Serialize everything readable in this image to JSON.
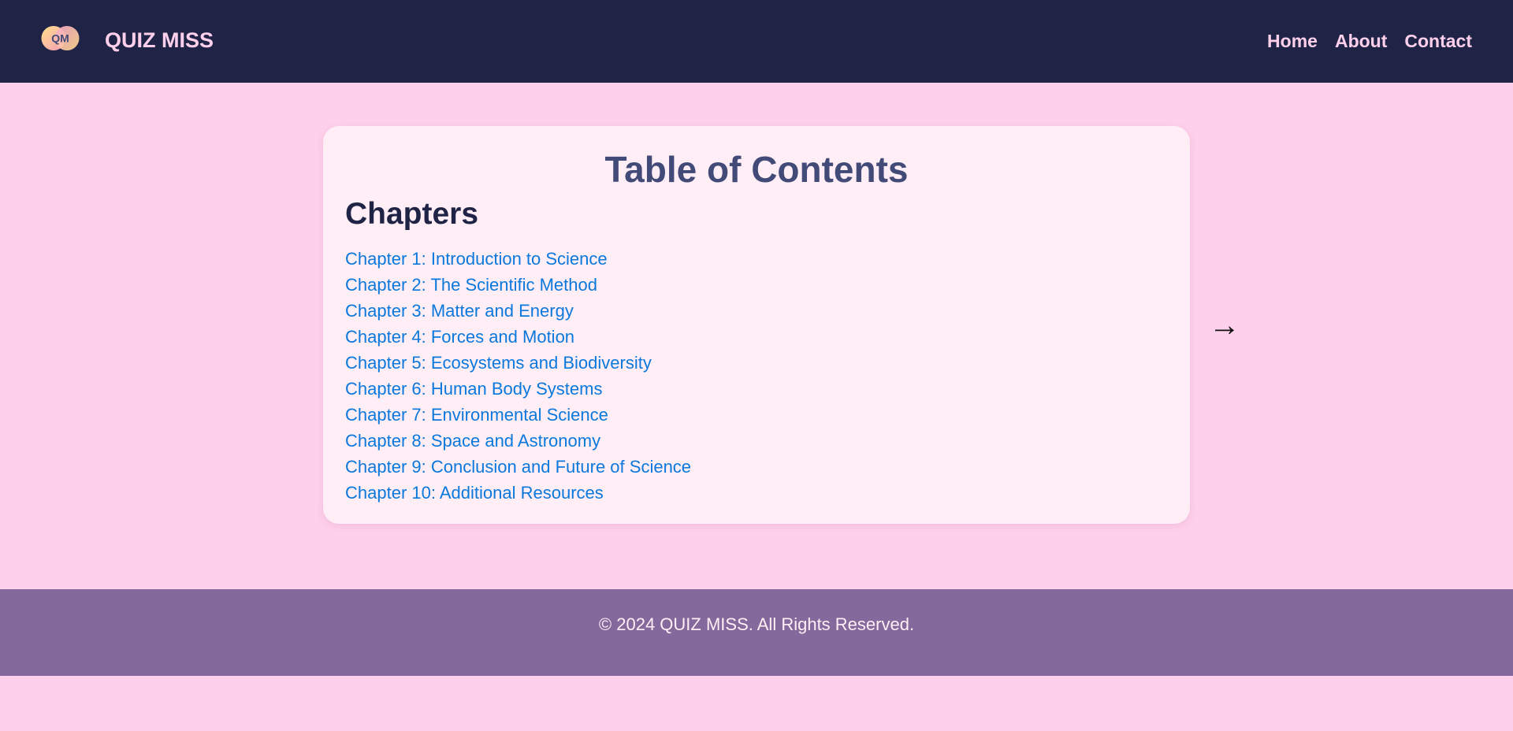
{
  "header": {
    "logo_text": "QM",
    "brand": "QUIZ MISS",
    "nav": [
      {
        "label": "Home"
      },
      {
        "label": "About"
      },
      {
        "label": "Contact"
      }
    ]
  },
  "main": {
    "title": "Table of Contents",
    "section_heading": "Chapters",
    "chapters": [
      {
        "label": "Chapter 1: Introduction to Science"
      },
      {
        "label": "Chapter 2: The Scientific Method"
      },
      {
        "label": "Chapter 3: Matter and Energy"
      },
      {
        "label": "Chapter 4: Forces and Motion"
      },
      {
        "label": "Chapter 5: Ecosystems and Biodiversity"
      },
      {
        "label": "Chapter 6: Human Body Systems"
      },
      {
        "label": "Chapter 7: Environmental Science"
      },
      {
        "label": "Chapter 8: Space and Astronomy"
      },
      {
        "label": "Chapter 9: Conclusion and Future of Science"
      },
      {
        "label": "Chapter 10: Additional Resources"
      }
    ],
    "next_arrow": "→"
  },
  "footer": {
    "text": "© 2024 QUIZ MISS. All Rights Reserved."
  },
  "colors": {
    "header_bg": "#1f2446",
    "page_bg": "#ffd0eb",
    "card_bg": "#ffeef5",
    "title": "#424a78",
    "link": "#0a78dc",
    "footer_bg": "#83699c"
  }
}
